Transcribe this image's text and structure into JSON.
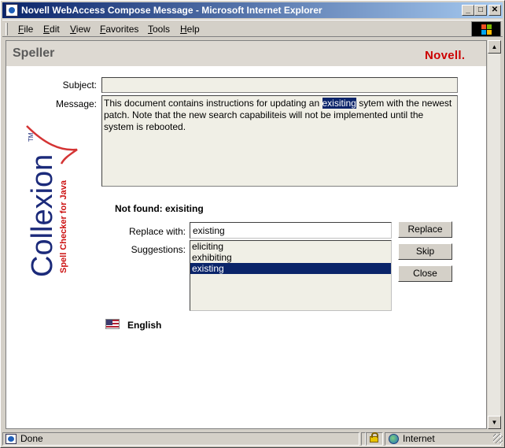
{
  "window": {
    "title": "Novell WebAccess Compose Message - Microsoft Internet Explorer",
    "min_glyph": "_",
    "max_glyph": "□",
    "close_glyph": "✕"
  },
  "menu": [
    "File",
    "Edit",
    "View",
    "Favorites",
    "Tools",
    "Help"
  ],
  "page": {
    "title": "Speller",
    "brand": "Novell."
  },
  "form": {
    "subject_label": "Subject:",
    "subject_value": "",
    "message_label": "Message:",
    "message_before": "This document contains instructions for updating an ",
    "message_highlight": "exisiting",
    "message_after": " sytem with the newest patch. Note that the new search capabiliteis will not be implemented until the system is rebooted."
  },
  "speller": {
    "not_found": "Not found: exisiting",
    "replace_label": "Replace with:",
    "replace_value": "existing",
    "suggestions_label": "Suggestions:",
    "suggestions": [
      "eliciting",
      "exhibiting",
      "existing"
    ],
    "selected_index": 2,
    "buttons": {
      "replace": "Replace",
      "skip": "Skip",
      "close": "Close"
    },
    "language": "English"
  },
  "logo": {
    "name": "Collexion",
    "tm": "TM",
    "tagline": "Spell Checker for Java"
  },
  "status": {
    "text": "Done",
    "zone": "Internet"
  },
  "colors": {
    "title_bar": "#0a246a",
    "selection": "#0a246a",
    "brand_red": "#cc0000",
    "logo_blue": "#1b2a7a"
  }
}
